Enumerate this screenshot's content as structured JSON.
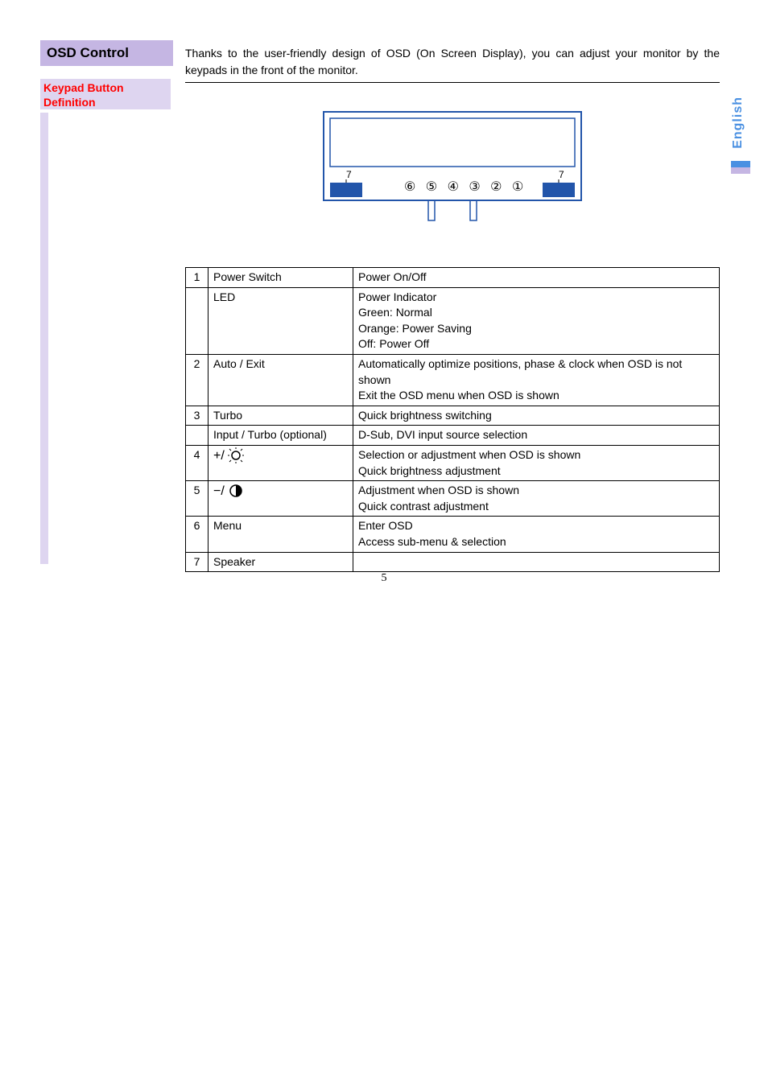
{
  "side_tab": "English",
  "section_title": "OSD Control",
  "sub_label_1": "Keypad Button",
  "sub_label_2": "Definition",
  "intro": "Thanks to the user-friendly design of OSD (On Screen Display), you can adjust your monitor by the keypads in the front of the monitor.",
  "diagram": {
    "left_num": "7",
    "right_num": "7",
    "circles": [
      "⑥",
      "⑤",
      "④",
      "③",
      "②",
      "①"
    ]
  },
  "table": {
    "rows": [
      {
        "n": "1",
        "name": "Power Switch",
        "desc": "Power On/Off"
      },
      {
        "n": "",
        "name": "LED",
        "desc": "Power Indicator\nGreen: Normal\nOrange: Power Saving\nOff: Power Off"
      },
      {
        "n": "2",
        "name": "Auto / Exit",
        "desc": "Automatically optimize positions, phase & clock when OSD is not shown\nExit the OSD menu when OSD is shown"
      },
      {
        "n": "3",
        "name": "Turbo",
        "desc": "Quick brightness switching"
      },
      {
        "n": "",
        "name": "Input / Turbo (optional)",
        "desc": "D-Sub, DVI input source selection"
      },
      {
        "n": "4",
        "name": "__ICON_SUN__",
        "desc": "Selection or adjustment when OSD is shown\nQuick brightness adjustment"
      },
      {
        "n": "5",
        "name": "__ICON_MOON__",
        "desc": "Adjustment when OSD is shown\nQuick contrast adjustment"
      },
      {
        "n": "6",
        "name": "Menu",
        "desc": "Enter OSD\nAccess sub-menu & selection"
      },
      {
        "n": "7",
        "name": "Speaker",
        "desc": ""
      }
    ]
  },
  "page_number": "5"
}
